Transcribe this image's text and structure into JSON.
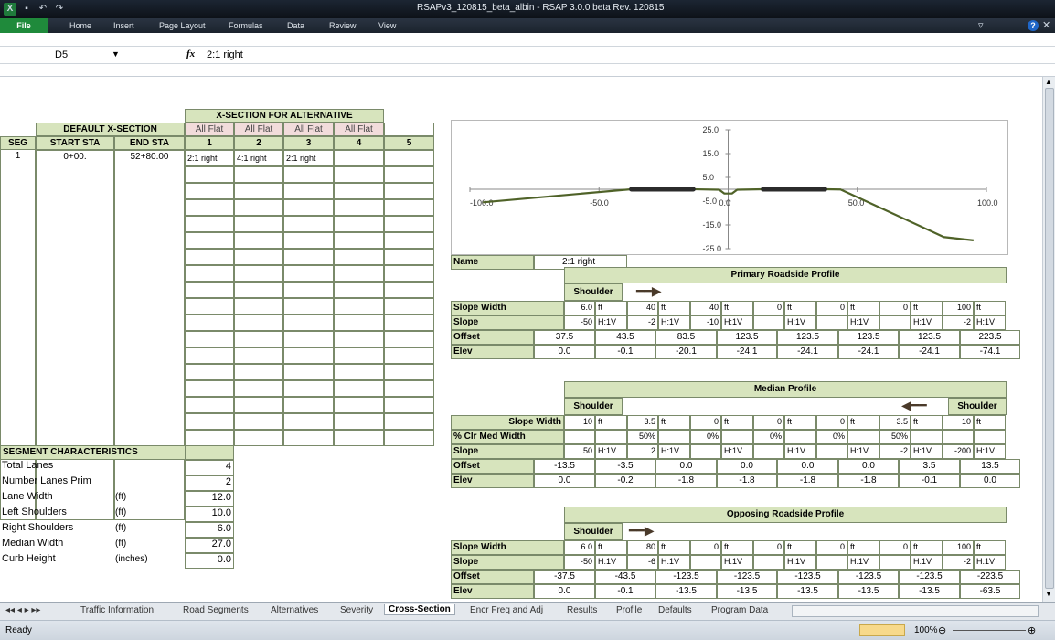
{
  "window": {
    "title": "RSAPv3_120815_beta_albin  -  RSAP 3.0.0 beta Rev. 120815"
  },
  "ribbon": {
    "file": "File",
    "tabs": [
      "Home",
      "Insert",
      "Page Layout",
      "Formulas",
      "Data",
      "Review",
      "View"
    ]
  },
  "formula_bar": {
    "name_box": "D5",
    "fx": "fx",
    "value": "2:1 right"
  },
  "left": {
    "default_header": "DEFAULT X-SECTION",
    "alt_header": "X-SECTION FOR ALTERNATIVE",
    "cols": [
      "SEG",
      "START STA",
      "END STA"
    ],
    "alt_names": [
      "All Flat",
      "All Flat",
      "All Flat",
      "All Flat",
      ""
    ],
    "alt_nums": [
      "1",
      "2",
      "3",
      "4",
      "5"
    ],
    "row1": {
      "seg": "1",
      "start": "0+00.",
      "end": "52+80.00",
      "alts": [
        "2:1 right",
        "4:1 right",
        "2:1 right",
        "",
        ""
      ]
    }
  },
  "segchar": {
    "title": "SEGMENT CHARACTERISTICS",
    "rows": [
      {
        "label": "Total Lanes",
        "unit": "",
        "value": "4"
      },
      {
        "label": "Number Lanes Prim",
        "unit": "",
        "value": "2"
      },
      {
        "label": "Lane Width",
        "unit": "(ft)",
        "value": "12.0"
      },
      {
        "label": "Left Shoulders",
        "unit": "(ft)",
        "value": "10.0"
      },
      {
        "label": "Right Shoulders",
        "unit": "(ft)",
        "value": "6.0"
      },
      {
        "label": "Median Width",
        "unit": "(ft)",
        "value": "27.0"
      },
      {
        "label": "Curb Height",
        "unit": "(inches)",
        "value": "0.0"
      }
    ]
  },
  "chart_data": {
    "type": "line",
    "xlim": [
      -100,
      100
    ],
    "ylim": [
      -25,
      25
    ],
    "x_ticks": [
      "-100.0",
      "-50.0",
      "0.0",
      "50.0",
      "100.0"
    ],
    "y_ticks": [
      "25.0",
      "15.0",
      "5.0",
      "-5.0",
      "-15.0",
      "-25.0"
    ],
    "profile": {
      "x": [
        -95,
        -37.5,
        -13.5,
        -3.5,
        -1.5,
        0,
        1.5,
        3.5,
        13.5,
        37.5,
        43.5,
        83.5,
        95
      ],
      "y": [
        -5.5,
        0.0,
        0.0,
        -0.2,
        -1.8,
        -1.8,
        -1.8,
        -0.2,
        0.0,
        0.0,
        -0.1,
        -20.1,
        -21.5
      ]
    },
    "lanes": [
      {
        "x": [
          -37.5,
          -13.5
        ],
        "y": [
          0,
          0
        ]
      },
      {
        "x": [
          13.5,
          37.5
        ],
        "y": [
          0,
          0
        ]
      }
    ]
  },
  "name_row": {
    "label": "Name",
    "value": "2:1 right"
  },
  "primary": {
    "title": "Primary Roadside Profile",
    "shoulder": "Shoulder",
    "slope_width_label": "Slope Width",
    "slope_width": [
      "6.0",
      "40",
      "40",
      "0",
      "0",
      "0",
      "100"
    ],
    "slope_label": "Slope",
    "slope": [
      "-50",
      "-2",
      "-10",
      "",
      "",
      "",
      "-2"
    ],
    "ft": "ft",
    "hv": "H:1V",
    "offset_label": "Offset",
    "offset": [
      "37.5",
      "43.5",
      "83.5",
      "123.5",
      "123.5",
      "123.5",
      "123.5",
      "223.5"
    ],
    "elev_label": "Elev",
    "elev": [
      "0.0",
      "-0.1",
      "-20.1",
      "-24.1",
      "-24.1",
      "-24.1",
      "-24.1",
      "-74.1"
    ]
  },
  "median": {
    "title": "Median Profile",
    "shoulder_left": "Shoulder",
    "shoulder_right": "Shoulder",
    "slope_width_label": "Slope Width",
    "slope_width": [
      "10",
      "3.5",
      "0",
      "0",
      "0",
      "3.5",
      "10"
    ],
    "clr_label": "% Clr Med Width",
    "clr": [
      "",
      "50%",
      "0%",
      "0%",
      "0%",
      "50%",
      ""
    ],
    "slope_label": "Slope",
    "slope": [
      "50",
      "2",
      "",
      "",
      "",
      "-2",
      "-200"
    ],
    "offset_label": "Offset",
    "offset": [
      "-13.5",
      "-3.5",
      "0.0",
      "0.0",
      "0.0",
      "0.0",
      "3.5",
      "13.5"
    ],
    "elev_label": "Elev",
    "elev": [
      "0.0",
      "-0.2",
      "-1.8",
      "-1.8",
      "-1.8",
      "-1.8",
      "-0.1",
      "0.0"
    ]
  },
  "opposing": {
    "title": "Opposing Roadside Profile",
    "shoulder": "Shoulder",
    "slope_width_label": "Slope Width",
    "slope_width": [
      "6.0",
      "80",
      "0",
      "0",
      "0",
      "0",
      "100"
    ],
    "slope_label": "Slope",
    "slope": [
      "-50",
      "-6",
      "",
      "",
      "",
      "",
      "-2"
    ],
    "offset_label": "Offset",
    "offset": [
      "-37.5",
      "-43.5",
      "-123.5",
      "-123.5",
      "-123.5",
      "-123.5",
      "-123.5",
      "-223.5"
    ],
    "elev_label": "Elev",
    "elev": [
      "0.0",
      "-0.1",
      "-13.5",
      "-13.5",
      "-13.5",
      "-13.5",
      "-13.5",
      "-63.5"
    ]
  },
  "sheet_tabs": [
    "Traffic Information",
    "Road Segments",
    "Alternatives",
    "Severity",
    "Cross-Section",
    "Encr Freq and Adj",
    "Results",
    "Profile",
    "Defaults",
    "Program Data"
  ],
  "active_tab": "Cross-Section",
  "status": {
    "ready": "Ready",
    "zoom": "100%"
  },
  "colors": {
    "header_green": "#d7e4bd",
    "header_pink": "#f2dcdb",
    "line_green": "#4f6228",
    "lane_dark": "#2b2b2b"
  }
}
